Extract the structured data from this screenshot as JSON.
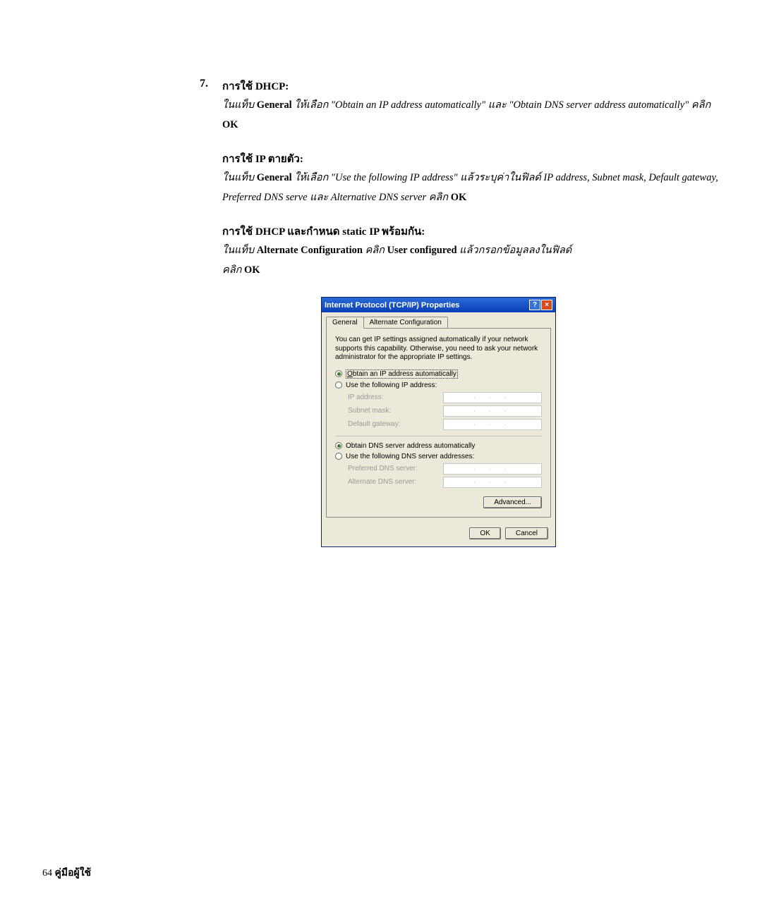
{
  "step": {
    "number": "7."
  },
  "sections": {
    "dhcp": {
      "heading": "การใช้ DHCP:",
      "line1_a": "ในแท็บ ",
      "line1_b": "General",
      "line1_c": " ให้เลือก \"Obtain an IP address automatically\" และ \"Obtain DNS server address automatically\" คลิก ",
      "line1_d": "OK"
    },
    "static": {
      "heading": "การใช้ IP ตายตัว:",
      "line1_a": "ในแท็บ ",
      "line1_b": "General",
      "line1_c": " ให้เลือก \"Use the following IP address\" แล้วระบุค่าในฟิลด์ IP address, Subnet mask, Default gateway,",
      "line2": "Preferred DNS serve และ Alternative DNS server คลิก ",
      "line2_b": "OK"
    },
    "both": {
      "heading": "การใช้ DHCP และกำหนด static IP พร้อมกัน:",
      "line1_a": "ในแท็บ ",
      "line1_b": "Alternate Configuration",
      "line1_c": " คลิก ",
      "line1_d": "User configured",
      "line1_e": " แล้วกรอกข้อมูลลงในฟิลด์",
      "line2_a": "คลิก ",
      "line2_b": "OK"
    }
  },
  "dialog": {
    "title": "Internet Protocol (TCP/IP) Properties",
    "tabs": {
      "general": "General",
      "alt": "Alternate Configuration"
    },
    "desc": "You can get IP settings assigned automatically if your network supports this capability. Otherwise, you need to ask your network administrator for the appropriate IP settings.",
    "radios": {
      "obtain_ip": "Obtain an IP address automatically",
      "use_ip": "Use the following IP address:",
      "obtain_dns": "Obtain DNS server address automatically",
      "use_dns": "Use the following DNS server addresses:"
    },
    "fields": {
      "ip": "IP address:",
      "subnet": "Subnet mask:",
      "gateway": "Default gateway:",
      "pdns": "Preferred DNS server:",
      "adns": "Alternate DNS server:"
    },
    "dots": ".   .   .",
    "buttons": {
      "adv": "Advanced...",
      "ok": "OK",
      "cancel": "Cancel"
    }
  },
  "footer": {
    "page": "64",
    "label": "คู่มือผู้ใช้"
  }
}
